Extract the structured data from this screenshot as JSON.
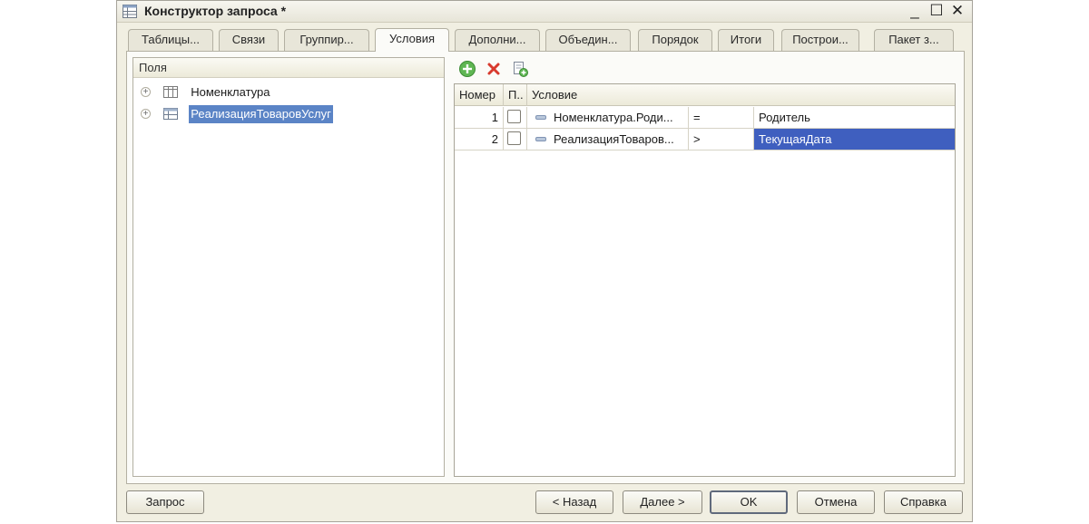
{
  "window": {
    "title": "Конструктор запроса *"
  },
  "window_controls": {
    "minimize": "_",
    "maximize": "☐",
    "close": "✕"
  },
  "tabs": [
    {
      "label": "Таблицы..."
    },
    {
      "label": "Связи"
    },
    {
      "label": "Группир..."
    },
    {
      "label": "Условия",
      "active": true
    },
    {
      "label": "Дополни..."
    },
    {
      "label": "Объедин..."
    },
    {
      "label": "Порядок"
    },
    {
      "label": "Итоги"
    },
    {
      "label": "Построи..."
    },
    {
      "label": "Пакет з..."
    }
  ],
  "fields_panel": {
    "header": "Поля",
    "items": [
      {
        "label": "Номенклатура",
        "expander": "+",
        "icon": "table-icon"
      },
      {
        "label": "РеализацияТоваровУслуг",
        "expander": "+",
        "icon": "document-table-icon",
        "selected": true
      }
    ]
  },
  "conditions_toolbar": {
    "add": "add-icon",
    "delete": "delete-icon",
    "copy": "copy-icon"
  },
  "conditions_table": {
    "columns": [
      "Номер",
      "П..",
      "Условие"
    ],
    "rows": [
      {
        "number": "1",
        "checked": false,
        "field": "Номенклатура.Роди...",
        "operator": "=",
        "value": "Родитель"
      },
      {
        "number": "2",
        "checked": false,
        "field": "РеализацияТоваров...",
        "operator": ">",
        "value": "ТекущаяДата",
        "selected": true
      }
    ]
  },
  "buttons": {
    "query": "Запрос",
    "back": "< Назад",
    "next": "Далее >",
    "ok": "OK",
    "cancel": "Отмена",
    "help": "Справка"
  },
  "colors": {
    "selection": "#5b84c6",
    "active_cell": "#3f5fbf",
    "window_bg": "#f1efe2"
  }
}
